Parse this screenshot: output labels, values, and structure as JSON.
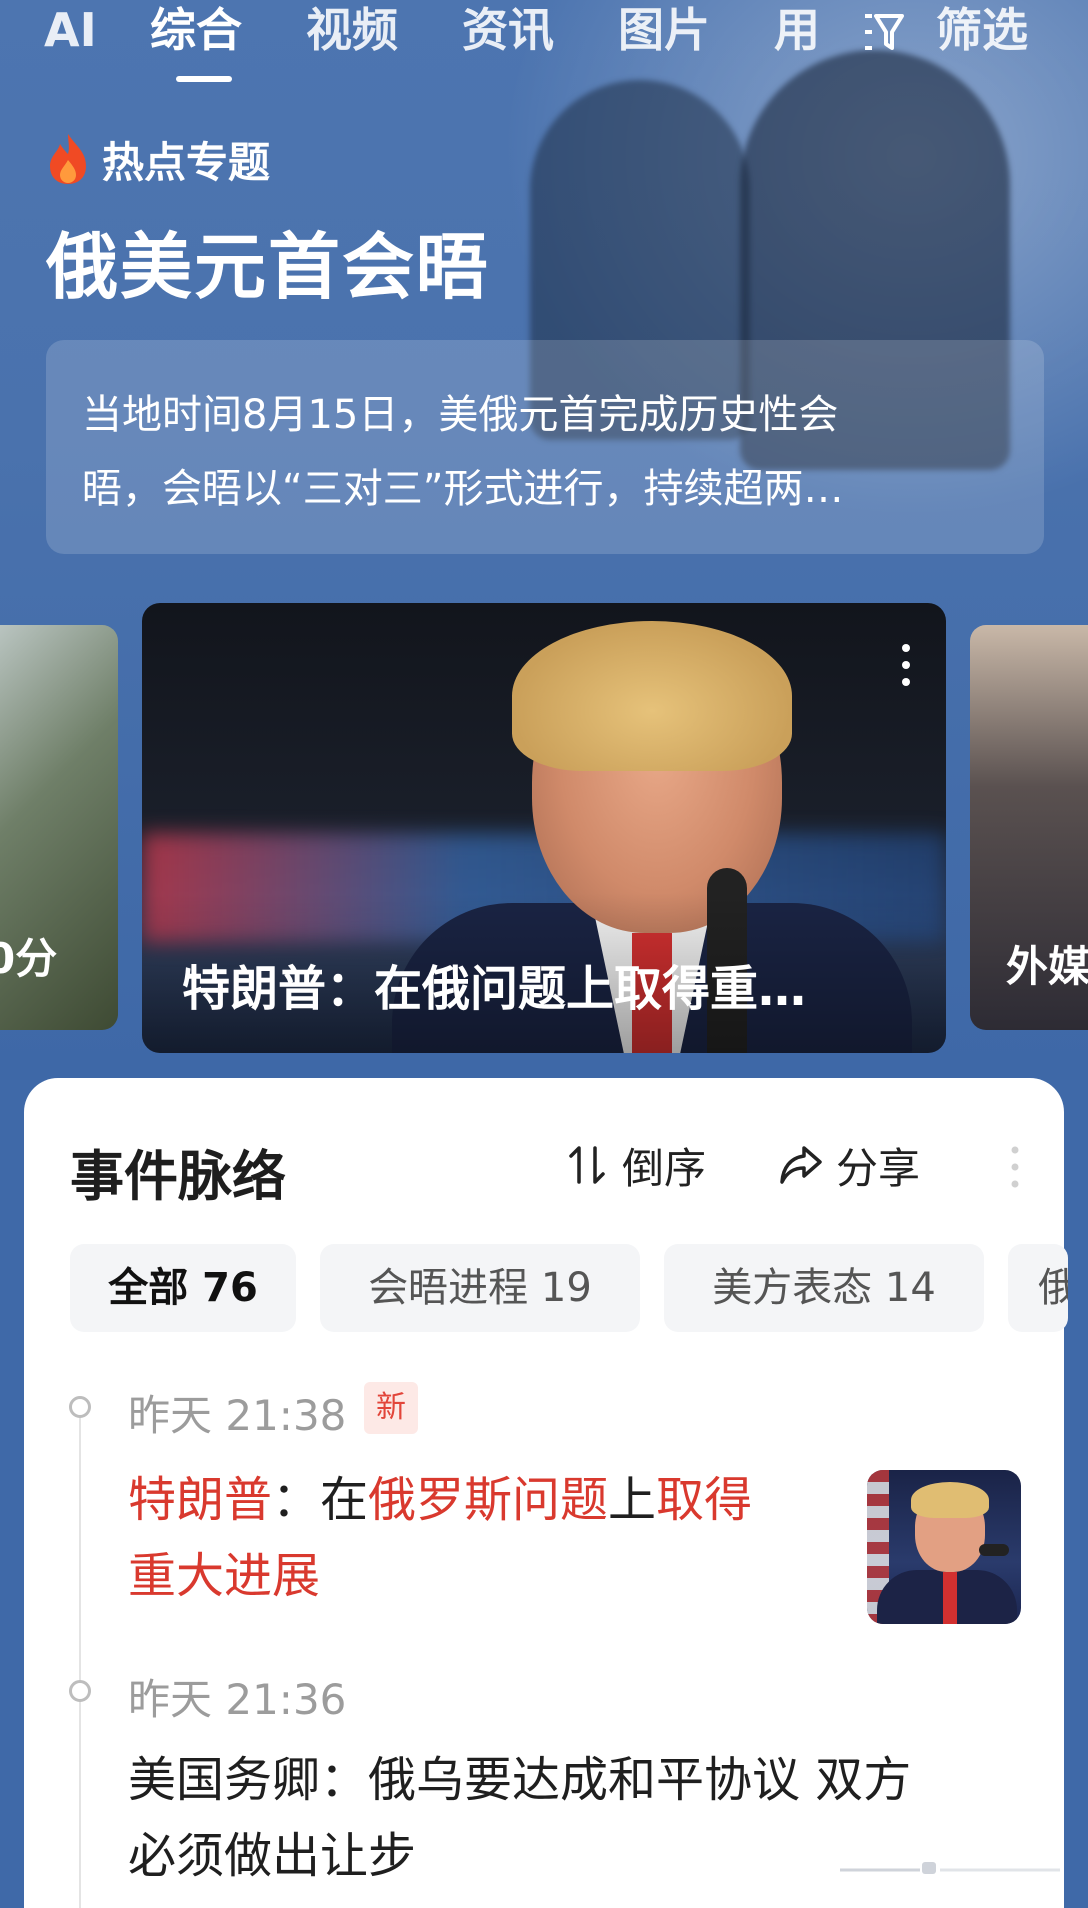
{
  "nav": {
    "tabs": [
      {
        "label": "AI"
      },
      {
        "label": "综合"
      },
      {
        "label": "视频"
      },
      {
        "label": "资讯"
      },
      {
        "label": "图片"
      },
      {
        "label": "用"
      }
    ],
    "filter_label": "筛选",
    "active_tab": "综合"
  },
  "hot_topic": {
    "label": "热点专题",
    "title": "俄美元首会晤",
    "summary_line1": "当地时间8月15日，美俄元首完成历史性会",
    "summary_line2": "晤，会晤以“三对三”形式进行，持续超两…"
  },
  "carousel": {
    "left_caption": "0分",
    "main_caption": "特朗普：在俄问题上取得重…",
    "right_caption": "外媒"
  },
  "timeline": {
    "title": "事件脉络",
    "sort_label": "倒序",
    "share_label": "分享",
    "chips": [
      {
        "label": "全部 76"
      },
      {
        "label": "会晤进程 19"
      },
      {
        "label": "美方表态 14"
      },
      {
        "label": "俄"
      }
    ],
    "events": [
      {
        "time": "昨天 21:38",
        "badge": "新",
        "headline_parts": [
          "特朗普",
          "：在",
          "俄罗斯问题",
          "上",
          "取得",
          "重大进展"
        ]
      },
      {
        "time": "昨天 21:36",
        "line1": "美国务卿：俄乌要达成和平协议 双方",
        "line2": "必须做出让步"
      }
    ]
  },
  "colors": {
    "background": "#3f69a8",
    "highlight_red": "#d9392e",
    "badge_bg": "#fde9e6"
  }
}
